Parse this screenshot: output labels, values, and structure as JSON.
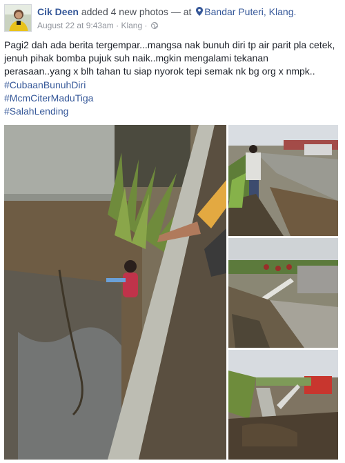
{
  "post": {
    "author": "Cik Deen",
    "action": "added 4 new photos",
    "at_separator": "— at",
    "location": "Bandar Puteri, Klang.",
    "date": "August 22 at 9:43am",
    "dot": "·",
    "place_short": "Klang",
    "audience_icon": "globe-icon",
    "location_icon": "map-pin-icon",
    "text": "Pagi2 dah ada berita tergempar...mangsa nak bunuh diri tp air parit pla cetek, jenuh pihak bomba pujuk suh naik..mgkin mengalami tekanan perasaan..yang x blh tahan tu siap nyorok tepi semak nk bg org x nmpk..",
    "hashtags": [
      "#CubaanBunuhDiri",
      "#McmCiterMaduTiga",
      "#SalahLending"
    ]
  },
  "colors": {
    "link": "#365899",
    "text": "#1d2129",
    "meta": "#90949c"
  },
  "photos": [
    {
      "name": "photo-woman-in-drain"
    },
    {
      "name": "photo-crowd-by-drain"
    },
    {
      "name": "photo-firemen-ladder"
    },
    {
      "name": "photo-fire-truck-scene"
    }
  ]
}
